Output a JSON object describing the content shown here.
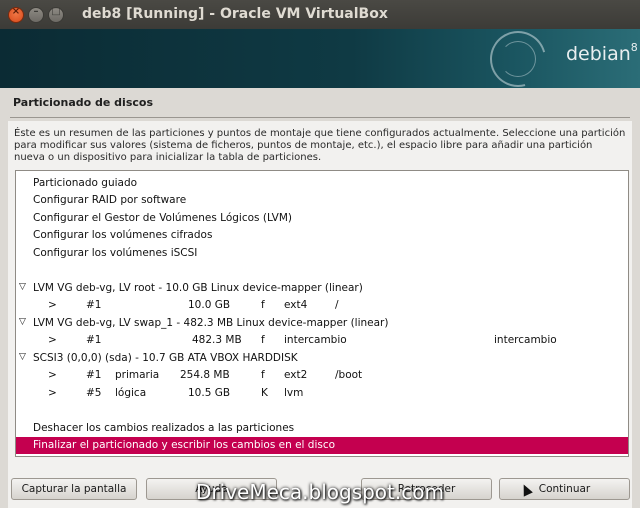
{
  "window": {
    "title": "deb8 [Running] - Oracle VM VirtualBox"
  },
  "banner": {
    "logo_text": "debian",
    "logo_version": "8"
  },
  "page": {
    "title": "Particionado de discos",
    "intro": "Éste es un resumen de las particiones y puntos de montaje que tiene configurados actualmente. Seleccione una partición para modificar sus valores (sistema de ficheros, puntos de montaje, etc.), el espacio libre para añadir una partición nueva o un dispositivo para inicializar la tabla de particiones."
  },
  "list": {
    "menu": [
      "Particionado guiado",
      "Configurar RAID por software",
      "Configurar el Gestor de Volúmenes Lógicos (LVM)",
      "Configurar los volúmenes cifrados",
      "Configurar los volúmenes iSCSI"
    ],
    "lvm_root": {
      "header": "LVM VG deb-vg, LV root - 10.0 GB Linux device-mapper (linear)",
      "part": {
        "arrow": ">",
        "num": "#1",
        "size": "10.0 GB",
        "flag": "f",
        "fs": "ext4",
        "mount": "/"
      }
    },
    "lvm_swap": {
      "header": "LVM VG deb-vg, LV swap_1 - 482.3 MB Linux device-mapper (linear)",
      "part": {
        "arrow": ">",
        "num": "#1",
        "size": "482.3 MB",
        "flag": "f",
        "fs": "intercambio",
        "mount": "intercambio"
      }
    },
    "disk": {
      "header": "SCSI3 (0,0,0) (sda) - 10.7 GB ATA VBOX HARDDISK",
      "parts": [
        {
          "arrow": ">",
          "num": "#1",
          "type": "primaria",
          "size": "254.8 MB",
          "flag": "f",
          "fs": "ext2",
          "mount": "/boot"
        },
        {
          "arrow": ">",
          "num": "#5",
          "type": "lógica",
          "size": "10.5 GB",
          "flag": "K",
          "fs": "lvm",
          "mount": ""
        }
      ]
    },
    "undo": "Deshacer los cambios realizados a las particiones",
    "finish": "Finalizar el particionado y escribir los cambios en el disco"
  },
  "buttons": {
    "capture": "Capturar la pantalla",
    "help": "Ayuda",
    "back": "Retroceder",
    "continue": "Continuar"
  },
  "watermark": "DriveMeca.blogspot.com",
  "colors": {
    "selection": "#c4004f",
    "banner": "#0f3a44"
  }
}
